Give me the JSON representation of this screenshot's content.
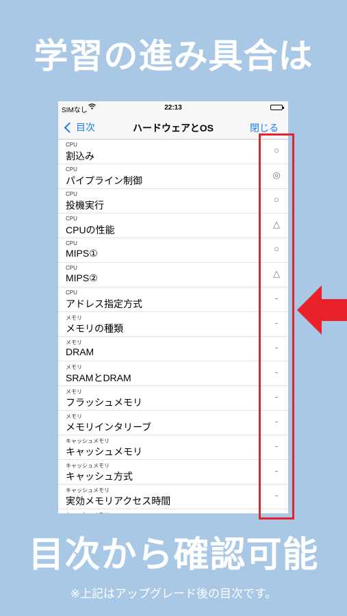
{
  "headline_top": "学習の進み具合は",
  "headline_bottom": "目次から確認可能",
  "footnote": "※上記はアップグレード後の目次です。",
  "status_bar": {
    "carrier": "SIMなし",
    "wifi_icon": "wifi-icon",
    "time": "22:13",
    "battery_icon": "battery-icon"
  },
  "nav": {
    "back_label": "目次",
    "title": "ハードウェアとOS",
    "close_label": "閉じる"
  },
  "rows": [
    {
      "category": "CPU",
      "name": "割込み",
      "mark": "○"
    },
    {
      "category": "CPU",
      "name": "パイプライン制御",
      "mark": "◎"
    },
    {
      "category": "CPU",
      "name": "投機実行",
      "mark": "○"
    },
    {
      "category": "CPU",
      "name": "CPUの性能",
      "mark": "△"
    },
    {
      "category": "CPU",
      "name": "MIPS①",
      "mark": "○"
    },
    {
      "category": "CPU",
      "name": "MIPS②",
      "mark": "△"
    },
    {
      "category": "CPU",
      "name": "アドレス指定方式",
      "mark": "-"
    },
    {
      "category": "メモリ",
      "name": "メモリの種類",
      "mark": "-"
    },
    {
      "category": "メモリ",
      "name": "DRAM",
      "mark": "-"
    },
    {
      "category": "メモリ",
      "name": "SRAMとDRAM",
      "mark": "-"
    },
    {
      "category": "メモリ",
      "name": "フラッシュメモリ",
      "mark": "-"
    },
    {
      "category": "メモリ",
      "name": "メモリインタリーブ",
      "mark": "-"
    },
    {
      "category": "キャッシュメモリ",
      "name": "キャッシュメモリ",
      "mark": "-"
    },
    {
      "category": "キャッシュメモリ",
      "name": "キャッシュ方式",
      "mark": "-"
    },
    {
      "category": "キャッシュメモリ",
      "name": "実効メモリアクセス時間",
      "mark": "-"
    },
    {
      "category": "キャッシュメモリ",
      "name": "",
      "mark": ""
    }
  ],
  "colors": {
    "background": "#a9c8e6",
    "accent_blue": "#1a7cf5",
    "highlight_red": "#e8212b"
  }
}
